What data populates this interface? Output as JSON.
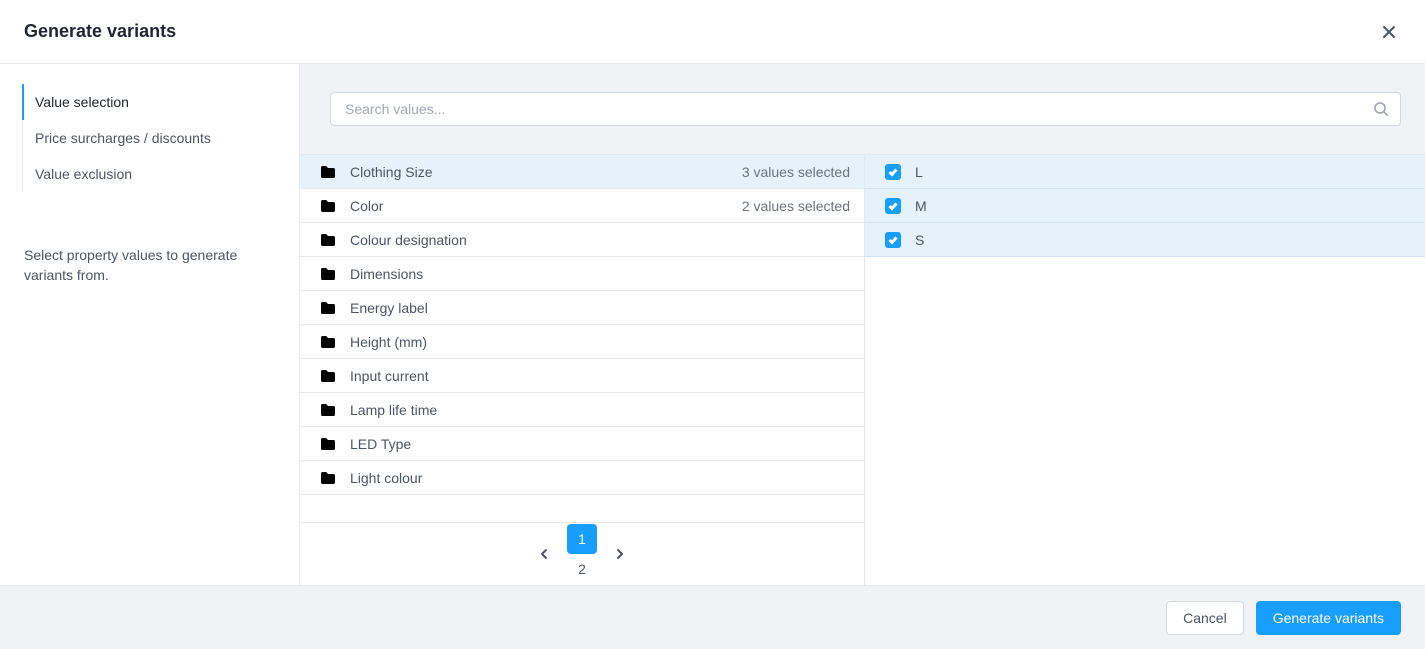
{
  "header": {
    "title": "Generate variants"
  },
  "sidebar": {
    "nav": [
      {
        "label": "Value selection",
        "active": true
      },
      {
        "label": "Price surcharges / discounts",
        "active": false
      },
      {
        "label": "Value exclusion",
        "active": false
      }
    ],
    "help_text": "Select property values to generate variants from."
  },
  "search": {
    "placeholder": "Search values..."
  },
  "properties": [
    {
      "label": "Clothing Size",
      "count_text": "3 values selected",
      "selected": true
    },
    {
      "label": "Color",
      "count_text": "2 values selected",
      "selected": false
    },
    {
      "label": "Colour designation",
      "count_text": "",
      "selected": false
    },
    {
      "label": "Dimensions",
      "count_text": "",
      "selected": false
    },
    {
      "label": "Energy label",
      "count_text": "",
      "selected": false
    },
    {
      "label": "Height (mm)",
      "count_text": "",
      "selected": false
    },
    {
      "label": "Input current",
      "count_text": "",
      "selected": false
    },
    {
      "label": "Lamp life time",
      "count_text": "",
      "selected": false
    },
    {
      "label": "LED Type",
      "count_text": "",
      "selected": false
    },
    {
      "label": "Light colour",
      "count_text": "",
      "selected": false
    }
  ],
  "values": [
    {
      "label": "L",
      "checked": true
    },
    {
      "label": "M",
      "checked": true
    },
    {
      "label": "S",
      "checked": true
    }
  ],
  "pagination": {
    "pages": [
      "1",
      "2"
    ],
    "active_index": 0
  },
  "footer": {
    "cancel": "Cancel",
    "confirm": "Generate variants"
  }
}
